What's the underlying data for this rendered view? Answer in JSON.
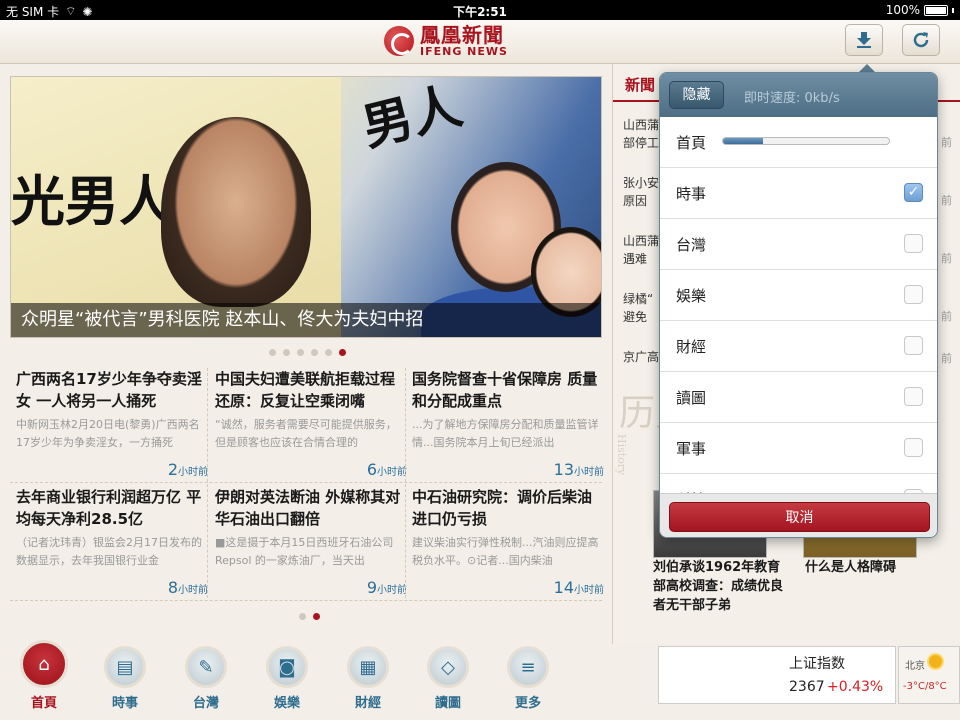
{
  "status_bar": {
    "carrier": "无 SIM 卡",
    "time": "下午2:51",
    "battery": "100%"
  },
  "header": {
    "logo_cn": "鳳凰新聞",
    "logo_en": "IFENG NEWS",
    "download_icon": "download-icon",
    "refresh_icon": "refresh-icon"
  },
  "hero": {
    "caption": "众明星“被代言”男科医院 赵本山、佟大为夫妇中招",
    "mag_text_1": "光男人",
    "mag_text_2": "男人"
  },
  "hero_dots": {
    "count": 6,
    "active_index": 5
  },
  "news": [
    {
      "title": "广西两名17岁少年争夺卖淫女 一人将另一人捅死",
      "snippet": "中新网玉林2月20日电(黎勇)广西两名17岁少年为争卖淫女，一方捅死",
      "time_num": "2",
      "time_unit": "小时前"
    },
    {
      "title": "中国夫妇遭美联航拒载过程还原：反复让空乘闭嘴",
      "snippet": "“诚然，服务者需要尽可能提供服务，但是顾客也应该在合情合理的",
      "time_num": "6",
      "time_unit": "小时前"
    },
    {
      "title": "国务院督查十省保障房 质量和分配成重点",
      "snippet": "...为了解地方保障房分配和质量监管详情...国务院本月上旬已经派出",
      "time_num": "13",
      "time_unit": "小时前"
    },
    {
      "title": "去年商业银行利润超万亿 平均每天净利28.5亿",
      "snippet": "（记者沈玮青）银监会2月17日发布的数据显示，去年我国银行业金",
      "time_num": "8",
      "time_unit": "小时前"
    },
    {
      "title": "伊朗对英法断油 外媒称其对华石油出口翻倍",
      "snippet": "■这是摄于本月15日西班牙石油公司Repsol 的一家炼油厂，当天出",
      "time_num": "9",
      "time_unit": "小时前"
    },
    {
      "title": "中石油研究院：调价后柴油进口仍亏损",
      "snippet": "建议柴油实行弹性税制...汽油则应提高税负水平。⊙记者...国内柴油",
      "time_num": "14",
      "time_unit": "小时前"
    }
  ],
  "grid_dots": {
    "count": 2,
    "active_index": 1
  },
  "right_column": {
    "header": "新聞",
    "items": [
      {
        "line1": "山西蒲",
        "line2": "部停工",
        "time": "前"
      },
      {
        "line1": "张小安",
        "line2": "原因",
        "time": "前"
      },
      {
        "line1": "山西蒲",
        "line2": "遇难",
        "time": "前"
      },
      {
        "line1": "绿橘“",
        "line2": "避免",
        "time": "前"
      },
      {
        "line1": "京广高",
        "line2": "",
        "time": "前"
      }
    ],
    "history_text": "历史",
    "history_en": "History",
    "captions": [
      "刘伯承谈1962年教育部高校调查：成绩优良者无干部子弟",
      "什么是人格障碍"
    ]
  },
  "stock": {
    "title": "上证指数",
    "value": "2367",
    "change": "+0.43%"
  },
  "weather": {
    "city": "北京",
    "temp": "-3°C/8°C",
    "icon": "sun-icon"
  },
  "tabs": [
    {
      "label": "首頁",
      "icon": "home-icon",
      "glyph": "⌂",
      "active": true
    },
    {
      "label": "時事",
      "icon": "newspaper-icon",
      "glyph": "▤",
      "active": false
    },
    {
      "label": "台灣",
      "icon": "taiwan-map-icon",
      "glyph": "✎",
      "active": false
    },
    {
      "label": "娛樂",
      "icon": "camera-icon",
      "glyph": "◙",
      "active": false
    },
    {
      "label": "財經",
      "icon": "chart-icon",
      "glyph": "▦",
      "active": false
    },
    {
      "label": "讀圖",
      "icon": "picture-icon",
      "glyph": "◇",
      "active": false
    },
    {
      "label": "更多",
      "icon": "more-icon",
      "glyph": "≡",
      "active": false
    }
  ],
  "popover": {
    "hide_label": "隐藏",
    "speed_text": "即时速度: 0kb/s",
    "progress": 0.24,
    "rows": [
      {
        "label": "首頁",
        "type": "progress"
      },
      {
        "label": "時事",
        "checked": true
      },
      {
        "label": "台灣",
        "checked": false
      },
      {
        "label": "娛樂",
        "checked": false
      },
      {
        "label": "財經",
        "checked": false
      },
      {
        "label": "讀圖",
        "checked": false
      },
      {
        "label": "軍事",
        "checked": false
      },
      {
        "label": "科技",
        "checked": false
      }
    ],
    "cancel_label": "取消"
  }
}
